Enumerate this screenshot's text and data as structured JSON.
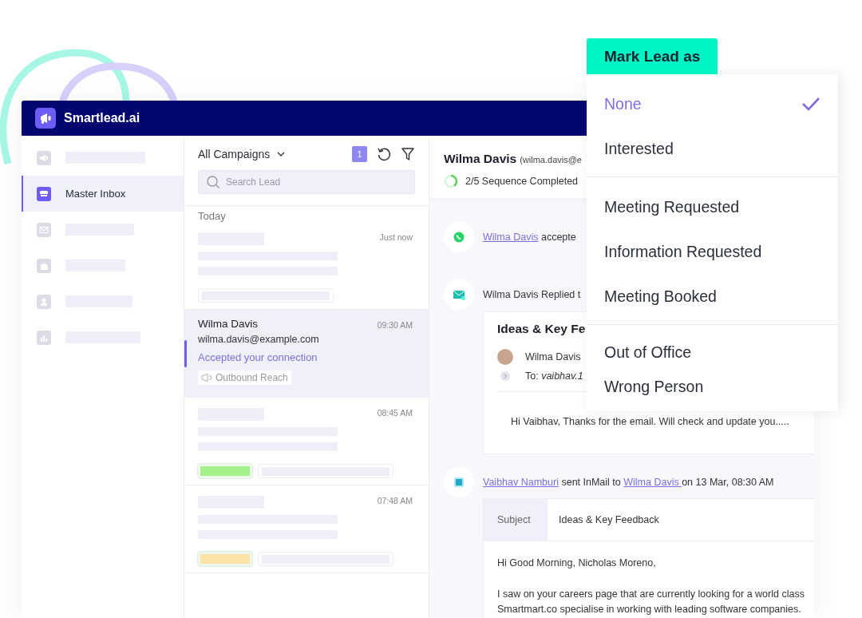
{
  "window": {
    "logo_text": "Smartlead.ai"
  },
  "sidebar": {
    "items": [
      {
        "kind": "megaphone",
        "selected": false
      },
      {
        "kind": "inbox",
        "label": "Master Inbox",
        "selected": true
      },
      {
        "kind": "mail",
        "selected": false
      },
      {
        "kind": "puzzle",
        "selected": false
      },
      {
        "kind": "person",
        "selected": false
      },
      {
        "kind": "chart",
        "selected": false
      }
    ]
  },
  "lead_list": {
    "campaign_filter": "All Campaigns",
    "badge": "1",
    "search": {
      "placeholder": "Search Lead"
    },
    "group_label": "Today",
    "leads": [
      {
        "time": "Just now",
        "selected": false
      },
      {
        "name": "Wilma Davis",
        "email": "wilma.davis@example.com",
        "status": "Accepted your connection",
        "campaign": "Outbound Reach",
        "time": "09:30 AM",
        "selected": true
      },
      {
        "time": "08:45 AM",
        "selected": false,
        "color": "#a6f08c"
      },
      {
        "time": "07:48 AM",
        "selected": false,
        "color": "#fde2a8"
      }
    ]
  },
  "detail": {
    "name": "Wilma Davis",
    "email": "(wilma.davis@e",
    "progress": {
      "label": "2/5 Sequence Completed",
      "level": 0.4
    },
    "events": [
      {
        "kind": "whatsapp",
        "parts": [
          {
            "text": "Wilma Davis",
            "link": true
          },
          {
            "text": " accepte",
            "link": false
          }
        ]
      },
      {
        "kind": "email",
        "parts": [
          {
            "text": "Wilma Davis Replied t",
            "link": false
          }
        ],
        "card": {
          "kind": "reply",
          "subject": "Ideas & Key Fe",
          "sender": "Wilma Davis",
          "recipient": "To: *vaibhav.1*",
          "body": [
            [
              "Hi Vaibhav, Thanks for the email. Will check and update you....."
            ]
          ]
        }
      },
      {
        "kind": "inmail",
        "parts": [
          {
            "text": "Vaibhav Namburi",
            "link": true
          },
          {
            "text": " sent InMail to ",
            "link": false
          },
          {
            "text": "Wilma Davis ",
            "link": true
          },
          {
            "text": "on 13 Mar, 08:30 AM",
            "link": false
          }
        ],
        "card": {
          "kind": "subject",
          "subject_label": "Subject",
          "subject": "Ideas & Key Feedback",
          "body": [
            [
              "Hi Good Morning, Nicholas Moreno,"
            ],
            [
              "I saw on your careers page that are currently looking for a world class",
              "Smartmart.co specialise in working with leading software companies."
            ]
          ]
        }
      }
    ]
  },
  "mark_lead_menu": {
    "title": "Mark Lead as",
    "groups": [
      {
        "options": [
          {
            "label": "None",
            "selected": true
          },
          {
            "label": "Interested",
            "selected": false
          }
        ]
      },
      {
        "options": [
          {
            "label": "Meeting Requested",
            "selected": false
          },
          {
            "label": "Information Requested",
            "selected": false
          },
          {
            "label": "Meeting Booked",
            "selected": false
          }
        ]
      },
      {
        "options": [
          {
            "label": "Out of Office",
            "selected": false
          },
          {
            "label": "Wrong Person",
            "selected": false
          }
        ]
      }
    ]
  }
}
